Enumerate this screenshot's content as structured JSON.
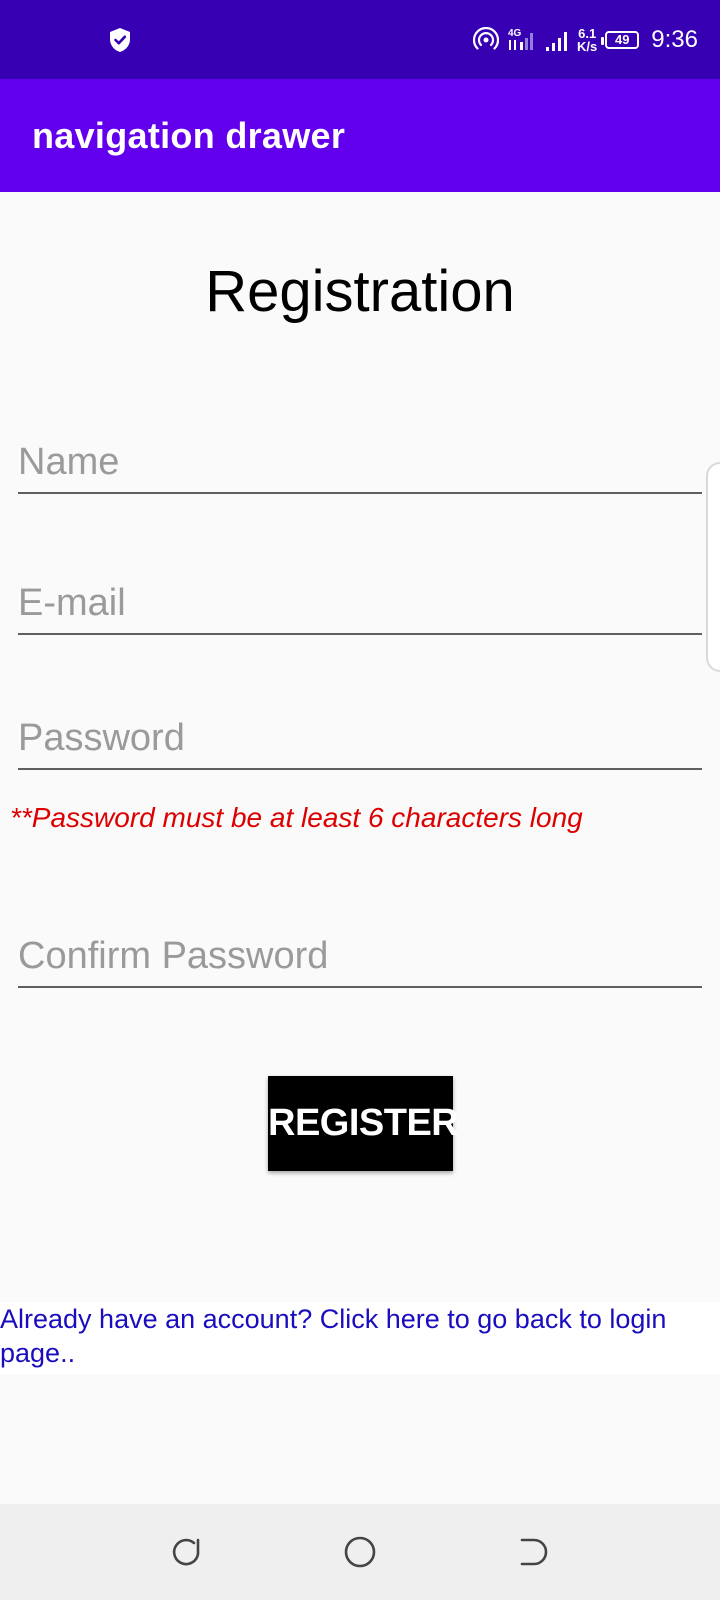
{
  "status_bar": {
    "time": "9:36",
    "battery_level": "49",
    "network_type": "4G",
    "speed_value": "6.1",
    "speed_unit": "K/s",
    "icons": [
      "shield-icon",
      "hotspot-icon",
      "signal-4g-icon",
      "signal-icon",
      "battery-icon"
    ]
  },
  "app_bar": {
    "title": "navigation drawer",
    "color": "#6200ee"
  },
  "form": {
    "title": "Registration",
    "name_placeholder": "Name",
    "name_value": "",
    "email_placeholder": "E-mail",
    "email_value": "",
    "password_placeholder": "Password",
    "password_value": "",
    "password_hint": "**Password must be at least 6 characters long",
    "confirm_placeholder": "Confirm Password",
    "confirm_value": "",
    "register_label": "REGISTER"
  },
  "login_link": {
    "text": "Already have an account? Click here to go back to login page.."
  },
  "nav_bar": {
    "icons": [
      "recents-icon",
      "home-icon",
      "back-icon"
    ]
  },
  "colors": {
    "status_bar": "#3700b3",
    "hint": "#dd0000",
    "link": "#1a0dbe",
    "button": "#000000"
  }
}
